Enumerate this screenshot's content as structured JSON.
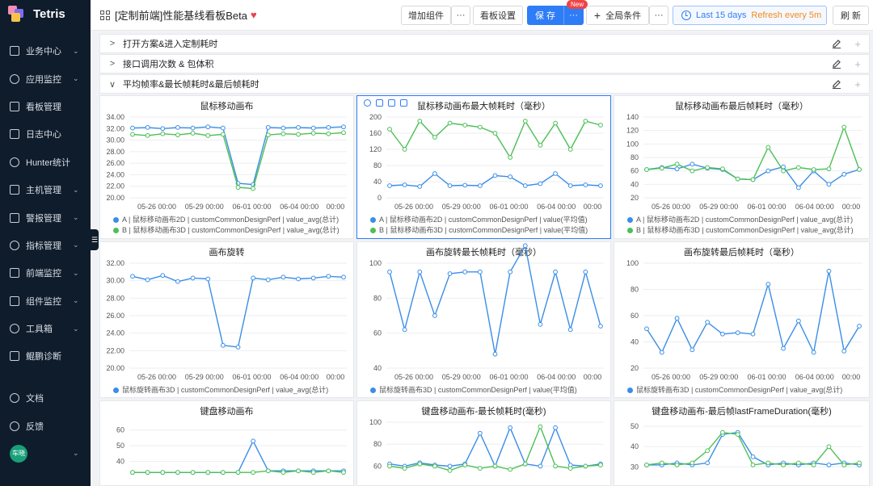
{
  "app": {
    "name": "Tetris"
  },
  "sidebar": {
    "items": [
      {
        "label": "业务中心",
        "icon": "business-icon",
        "chev": true
      },
      {
        "label": "应用监控",
        "icon": "search-icon",
        "chev": true
      },
      {
        "label": "看板管理",
        "icon": "dashboard-icon",
        "chev": false
      },
      {
        "label": "日志中心",
        "icon": "log-icon",
        "chev": false
      },
      {
        "label": "Hunter统计",
        "icon": "stats-icon",
        "chev": false
      },
      {
        "label": "主机管理",
        "icon": "host-icon",
        "chev": true
      },
      {
        "label": "警报管理",
        "icon": "alert-icon",
        "chev": true
      },
      {
        "label": "指标管理",
        "icon": "metric-icon",
        "chev": true
      },
      {
        "label": "前端监控",
        "icon": "frontend-icon",
        "chev": true
      },
      {
        "label": "组件监控",
        "icon": "component-icon",
        "chev": true
      },
      {
        "label": "工具箱",
        "icon": "toolbox-icon",
        "chev": true
      },
      {
        "label": "鲲鹏诊断",
        "icon": "diagnose-icon",
        "chev": false
      }
    ],
    "bottom": [
      {
        "label": "文档",
        "icon": "help-icon"
      },
      {
        "label": "反馈",
        "icon": "feedback-icon"
      }
    ],
    "user": {
      "avatar_text": "车晓"
    }
  },
  "header": {
    "title": "[定制前端]性能基线看板Beta",
    "add_component": "增加组件",
    "more": "···",
    "board_settings": "看板设置",
    "save": "保 存",
    "new_badge": "New",
    "global_conditions": "全局条件",
    "time_range": "Last 15 days",
    "refresh_rate": "Refresh every 5m",
    "refresh": "刷 新"
  },
  "sections": [
    {
      "title": "打开方案&进入定制耗时",
      "expanded": false
    },
    {
      "title": "接口调用次数 & 包体积",
      "expanded": false
    },
    {
      "title": "平均帧率&最长帧耗时&最后帧耗时",
      "expanded": true
    }
  ],
  "colors": {
    "blue": "#3a8ee6",
    "green": "#4cbf56",
    "accent": "#2f7df6",
    "sidebar": "#0f1c2b"
  },
  "chart_data": [
    {
      "type": "line",
      "title": "鼠标移动画布",
      "x": [
        "05-26 00:00",
        "05-29 00:00",
        "06-01 00:00",
        "06-04 00:00",
        "00:00"
      ],
      "yticks": [
        "34.00",
        "32.00",
        "30.00",
        "28.00",
        "26.00",
        "24.00",
        "22.00",
        "20.00"
      ],
      "ylim": [
        20,
        34
      ],
      "series": [
        {
          "name": "A | 鼠标移动画布2D | customCommonDesignPerf | value_avg(总计)",
          "color": "blue",
          "values": [
            32.1,
            32.2,
            32.0,
            32.2,
            32.1,
            32.3,
            32.1,
            22.5,
            22.3,
            32.2,
            32.1,
            32.2,
            32.1,
            32.2,
            32.3
          ]
        },
        {
          "name": "B | 鼠标移动画布3D | customCommonDesignPerf | value_avg(总计)",
          "color": "green",
          "values": [
            31.0,
            30.8,
            31.1,
            30.9,
            31.2,
            30.8,
            31.0,
            21.8,
            21.6,
            30.9,
            31.1,
            31.0,
            31.2,
            31.1,
            31.3
          ]
        }
      ]
    },
    {
      "type": "line",
      "title": "鼠标移动画布最大帧耗时（毫秒）",
      "x": [
        "05-26 00:00",
        "05-29 00:00",
        "06-01 00:00",
        "06-04 00:00",
        "00:00"
      ],
      "yticks": [
        "200",
        "160",
        "120",
        "80",
        "40",
        "0"
      ],
      "ylim": [
        0,
        200
      ],
      "series": [
        {
          "name": "A | 鼠标移动画布2D | customCommonDesignPerf | value(平均值)",
          "color": "blue",
          "values": [
            30,
            32,
            28,
            60,
            30,
            31,
            30,
            55,
            52,
            30,
            35,
            60,
            30,
            32,
            30
          ]
        },
        {
          "name": "B | 鼠标移动画布3D | customCommonDesignPerf | value(平均值)",
          "color": "green",
          "values": [
            170,
            120,
            190,
            150,
            185,
            180,
            175,
            160,
            100,
            190,
            130,
            185,
            120,
            190,
            180
          ]
        }
      ]
    },
    {
      "type": "line",
      "title": "鼠标移动画布最后帧耗时（毫秒）",
      "x": [
        "05-26 00:00",
        "05-29 00:00",
        "06-01 00:00",
        "06-04 00:00",
        "00:00"
      ],
      "yticks": [
        "140",
        "120",
        "100",
        "80",
        "60",
        "40",
        "20"
      ],
      "ylim": [
        20,
        140
      ],
      "series": [
        {
          "name": "A | 鼠标移动画布2D | customCommonDesignPerf | value_avg(总计)",
          "color": "blue",
          "values": [
            62,
            65,
            63,
            70,
            64,
            62,
            48,
            47,
            60,
            66,
            35,
            60,
            40,
            55,
            62
          ]
        },
        {
          "name": "B | 鼠标移动画布3D | customCommonDesignPerf | value_avg(总计)",
          "color": "green",
          "values": [
            62,
            64,
            70,
            60,
            65,
            63,
            48,
            47,
            95,
            60,
            65,
            62,
            63,
            125,
            62
          ]
        }
      ]
    },
    {
      "type": "line",
      "title": "画布旋转",
      "x": [
        "05-26 00:00",
        "05-29 00:00",
        "06-01 00:00",
        "06-04 00:00",
        "00:00"
      ],
      "yticks": [
        "32.00",
        "30.00",
        "28.00",
        "26.00",
        "24.00",
        "22.00",
        "20.00"
      ],
      "ylim": [
        20,
        32
      ],
      "series": [
        {
          "name": "鼠标旋转画布3D | customCommonDesignPerf | value_avg(总计)",
          "color": "blue",
          "values": [
            30.5,
            30.1,
            30.6,
            29.9,
            30.3,
            30.2,
            22.6,
            22.4,
            30.3,
            30.1,
            30.4,
            30.2,
            30.3,
            30.5,
            30.4
          ]
        }
      ]
    },
    {
      "type": "line",
      "title": "画布旋转最长帧耗时（毫秒）",
      "x": [
        "05-26 00:00",
        "05-29 00:00",
        "06-01 00:00",
        "06-04 00:00",
        "00:00"
      ],
      "yticks": [
        "100",
        "80",
        "60",
        "40"
      ],
      "ylim": [
        40,
        100
      ],
      "series": [
        {
          "name": "鼠标旋转画布3D | customCommonDesignPerf | value(平均值)",
          "color": "blue",
          "values": [
            95,
            62,
            95,
            70,
            94,
            95,
            95,
            48,
            95,
            110,
            65,
            95,
            62,
            95,
            64
          ]
        }
      ]
    },
    {
      "type": "line",
      "title": "画布旋转最后帧耗时（毫秒）",
      "x": [
        "05-26 00:00",
        "05-29 00:00",
        "06-01 00:00",
        "06-04 00:00",
        "00:00"
      ],
      "yticks": [
        "100",
        "80",
        "60",
        "40",
        "20"
      ],
      "ylim": [
        20,
        100
      ],
      "series": [
        {
          "name": "鼠标旋转画布3D | customCommonDesignPerf | value_avg(总计)",
          "color": "blue",
          "values": [
            50,
            32,
            58,
            34,
            55,
            46,
            47,
            46,
            84,
            35,
            56,
            32,
            94,
            33,
            52
          ]
        }
      ]
    },
    {
      "type": "line",
      "title": "键盘移动画布",
      "x": [],
      "yticks": [
        "60",
        "50",
        "40"
      ],
      "ylim": [
        30,
        65
      ],
      "series": [
        {
          "name": "",
          "color": "blue",
          "values": [
            33,
            33,
            33,
            33,
            33,
            33,
            33,
            33,
            53,
            34,
            34,
            34,
            34,
            34,
            34
          ]
        },
        {
          "name": "",
          "color": "green",
          "values": [
            33,
            33,
            33,
            33,
            33,
            33,
            33,
            33,
            33,
            34,
            33,
            34,
            33,
            34,
            33
          ]
        }
      ]
    },
    {
      "type": "line",
      "title": "键盘移动画布-最长帧耗时(毫秒)",
      "x": [],
      "yticks": [
        "100",
        "80",
        "60"
      ],
      "ylim": [
        50,
        100
      ],
      "series": [
        {
          "name": "",
          "color": "blue",
          "values": [
            62,
            60,
            63,
            61,
            60,
            62,
            90,
            60,
            95,
            62,
            60,
            95,
            61,
            60,
            62
          ]
        },
        {
          "name": "",
          "color": "green",
          "values": [
            60,
            58,
            62,
            60,
            56,
            61,
            58,
            60,
            57,
            62,
            96,
            60,
            58,
            60,
            61
          ]
        }
      ]
    },
    {
      "type": "line",
      "title": "键盘移动画布-最后帧lastFrameDuration(毫秒)",
      "x": [],
      "yticks": [
        "50",
        "40",
        "30"
      ],
      "ylim": [
        25,
        52
      ],
      "series": [
        {
          "name": "",
          "color": "blue",
          "values": [
            31,
            31,
            32,
            31,
            32,
            46,
            47,
            35,
            31,
            32,
            31,
            32,
            31,
            32,
            31
          ]
        },
        {
          "name": "",
          "color": "green",
          "values": [
            31,
            32,
            31,
            32,
            38,
            47,
            46,
            31,
            32,
            31,
            32,
            31,
            40,
            31,
            32
          ]
        }
      ]
    }
  ]
}
